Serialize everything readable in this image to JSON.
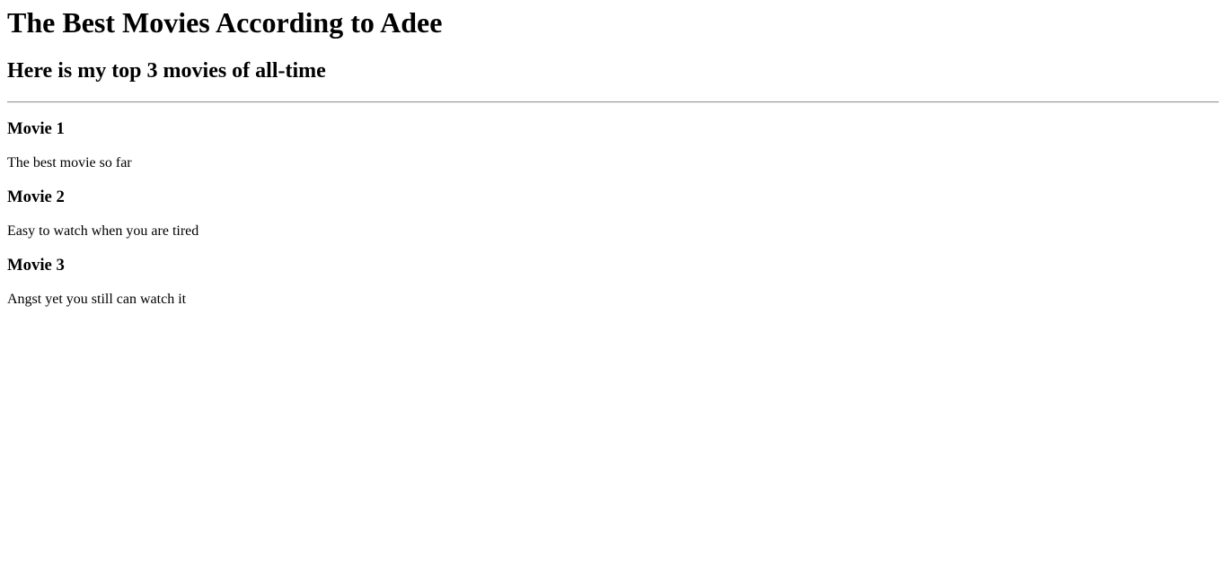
{
  "page": {
    "title": "The Best Movies According to Adee",
    "subtitle": "Here is my top 3 movies of all-time"
  },
  "movies": [
    {
      "name": "Movie 1",
      "description": "The best movie so far"
    },
    {
      "name": "Movie 2",
      "description": "Easy to watch when you are tired"
    },
    {
      "name": "Movie 3",
      "description": "Angst yet you still can watch it"
    }
  ]
}
